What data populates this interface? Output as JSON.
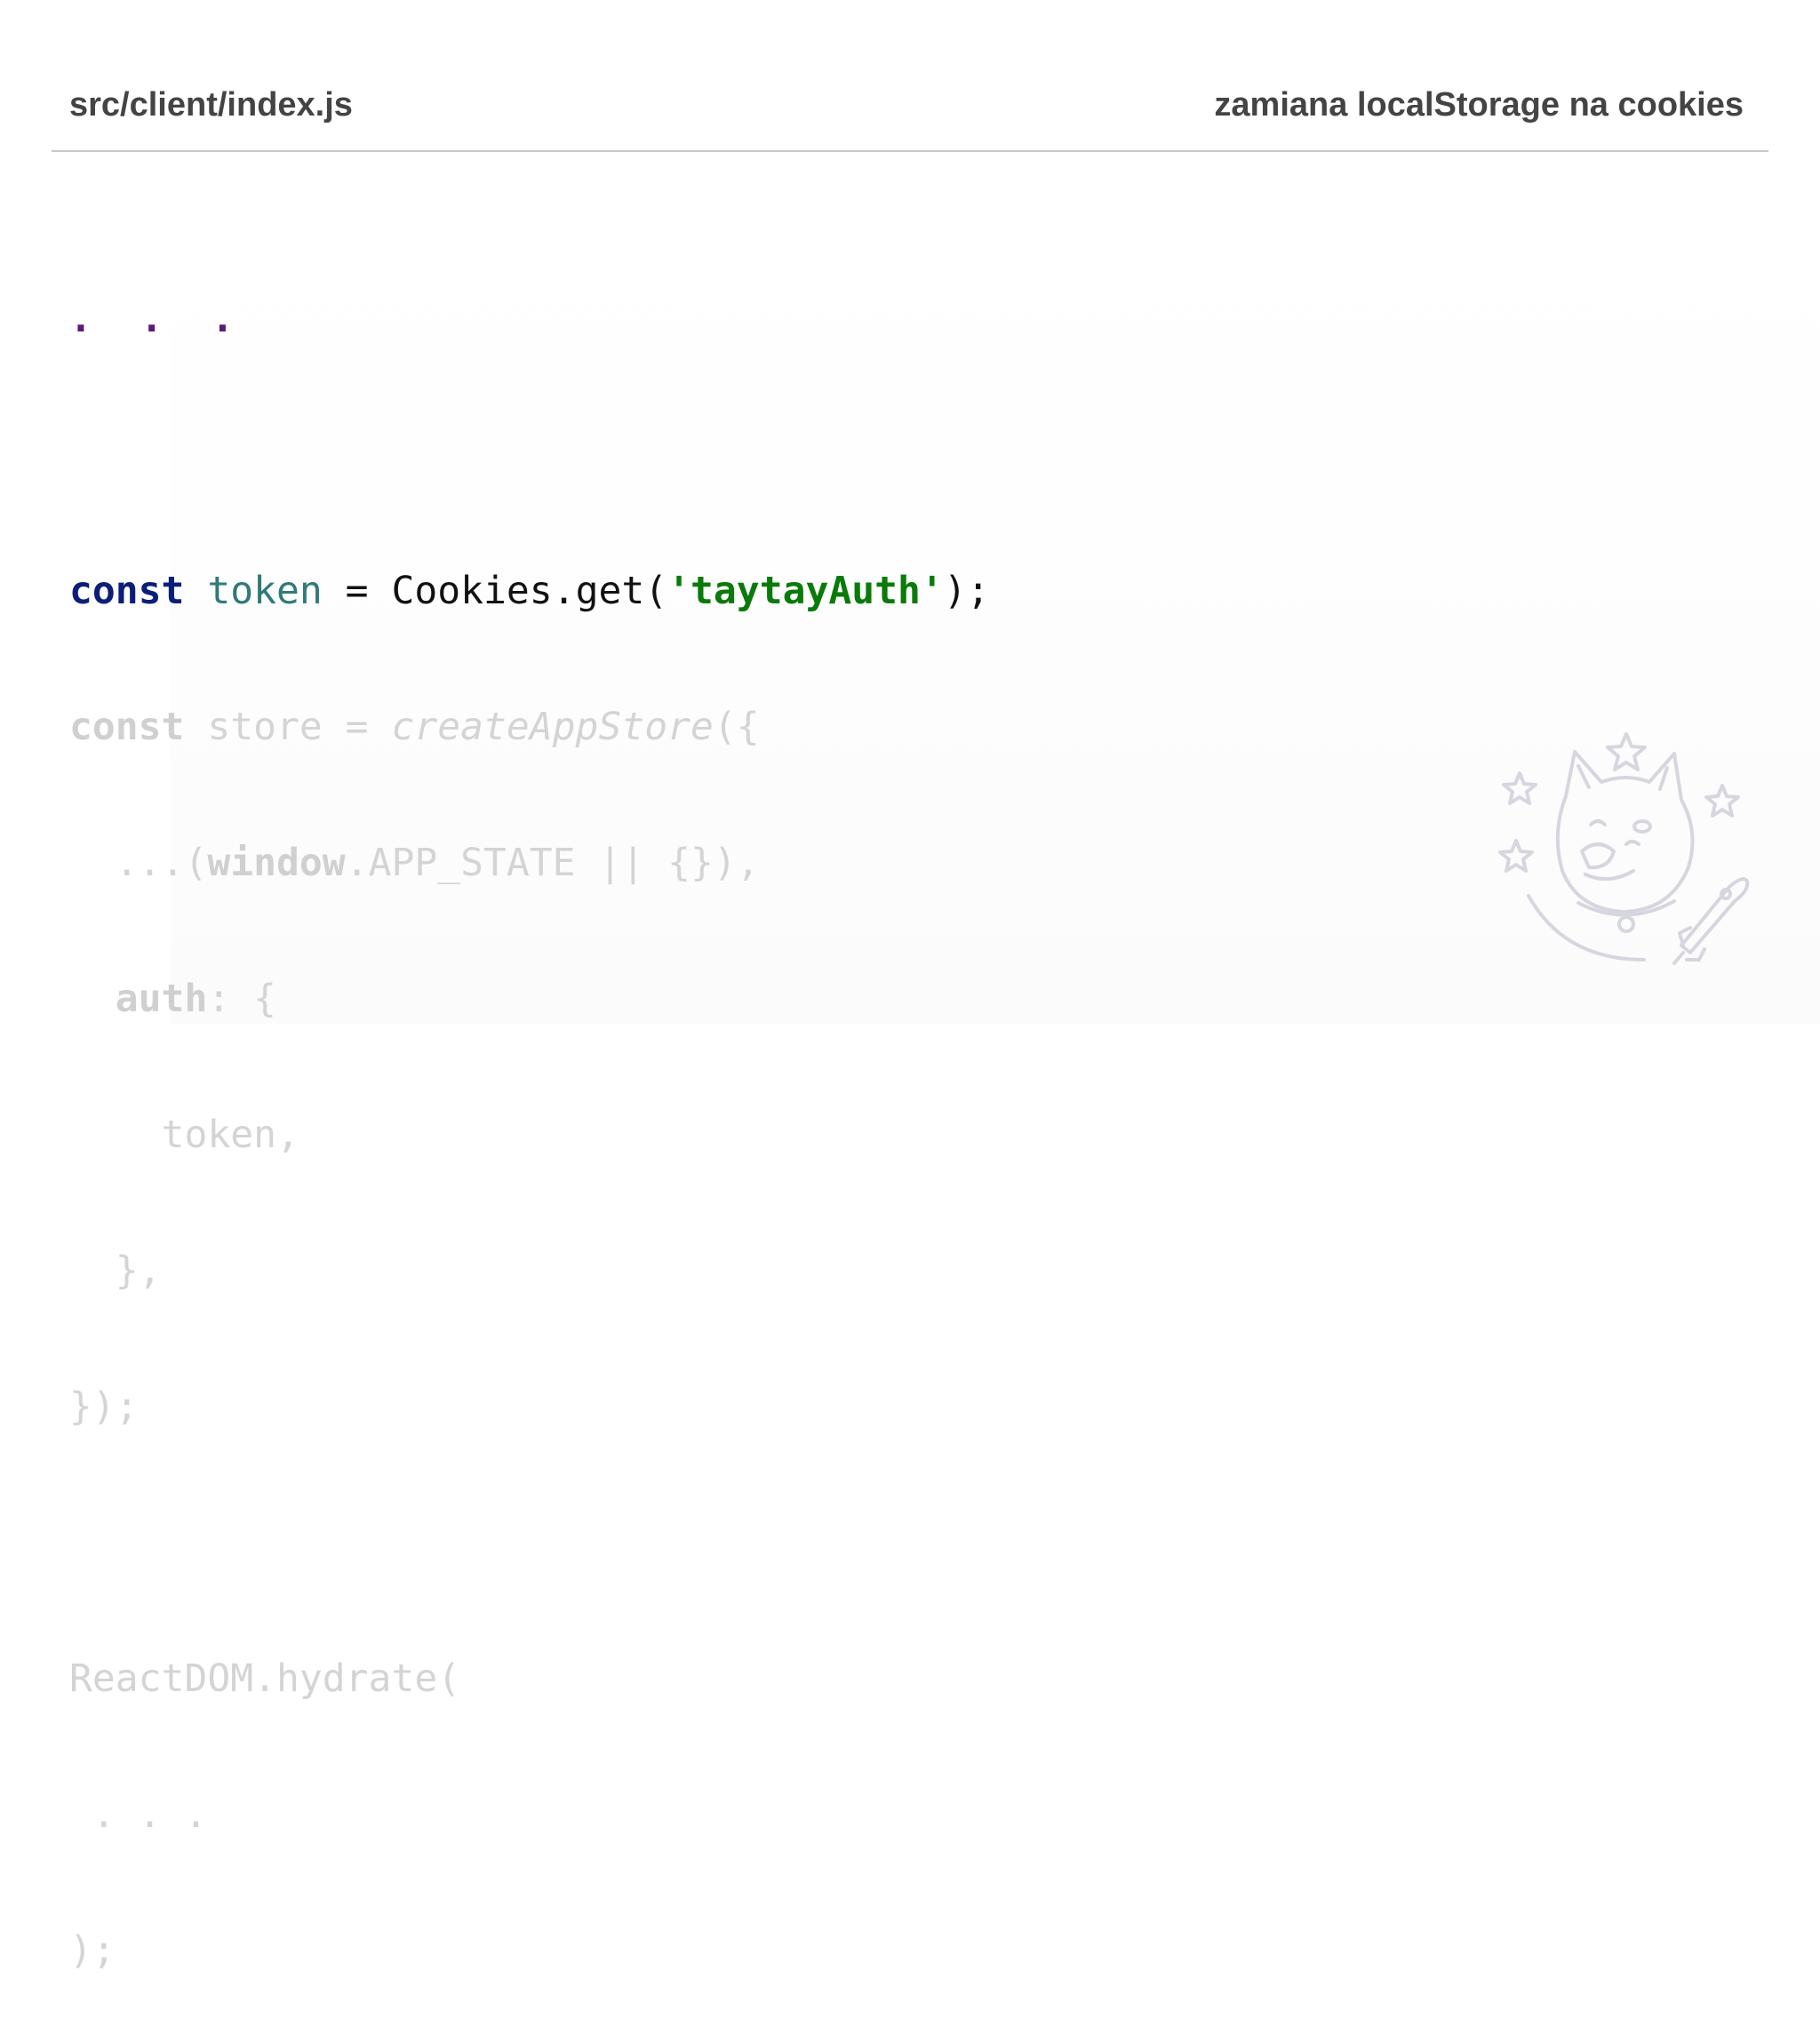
{
  "header": {
    "file_path": "src/client/index.js",
    "slide_title": "zamiana localStorage na cookies"
  },
  "code": {
    "ellipsis_top": ". . .",
    "line_token": {
      "kw": "const",
      "name": "token",
      "op": " = ",
      "call": "Cookies.get(",
      "arg": "'taytayAuth'",
      "end": ");"
    },
    "line_store": {
      "kw": "const",
      "rest": " store = ",
      "fn": "createAppStore",
      "end": "({"
    },
    "line_spread": {
      "pre": "  ...(",
      "window": "window",
      "rest": ".APP_STATE || {}),"
    },
    "line_auth": {
      "key": "  auth",
      "rest": ": {"
    },
    "line_token_prop": "    token,",
    "line_close_inner": "  },",
    "line_close_outer": "});",
    "line_blank": "",
    "line_hydrate": "ReactDOM.hydrate(",
    "line_ellipsis_inner": " . . .",
    "line_close_hydrate": ");"
  },
  "colors": {
    "keyword": "#0b1f7a",
    "variable": "#2f7a7a",
    "string": "#0a7a0a",
    "dimmed": "#d4d4d4",
    "ellipsis": "#5a1a7a"
  },
  "decoration": {
    "icon": "doge-rocket-stars-icon"
  }
}
